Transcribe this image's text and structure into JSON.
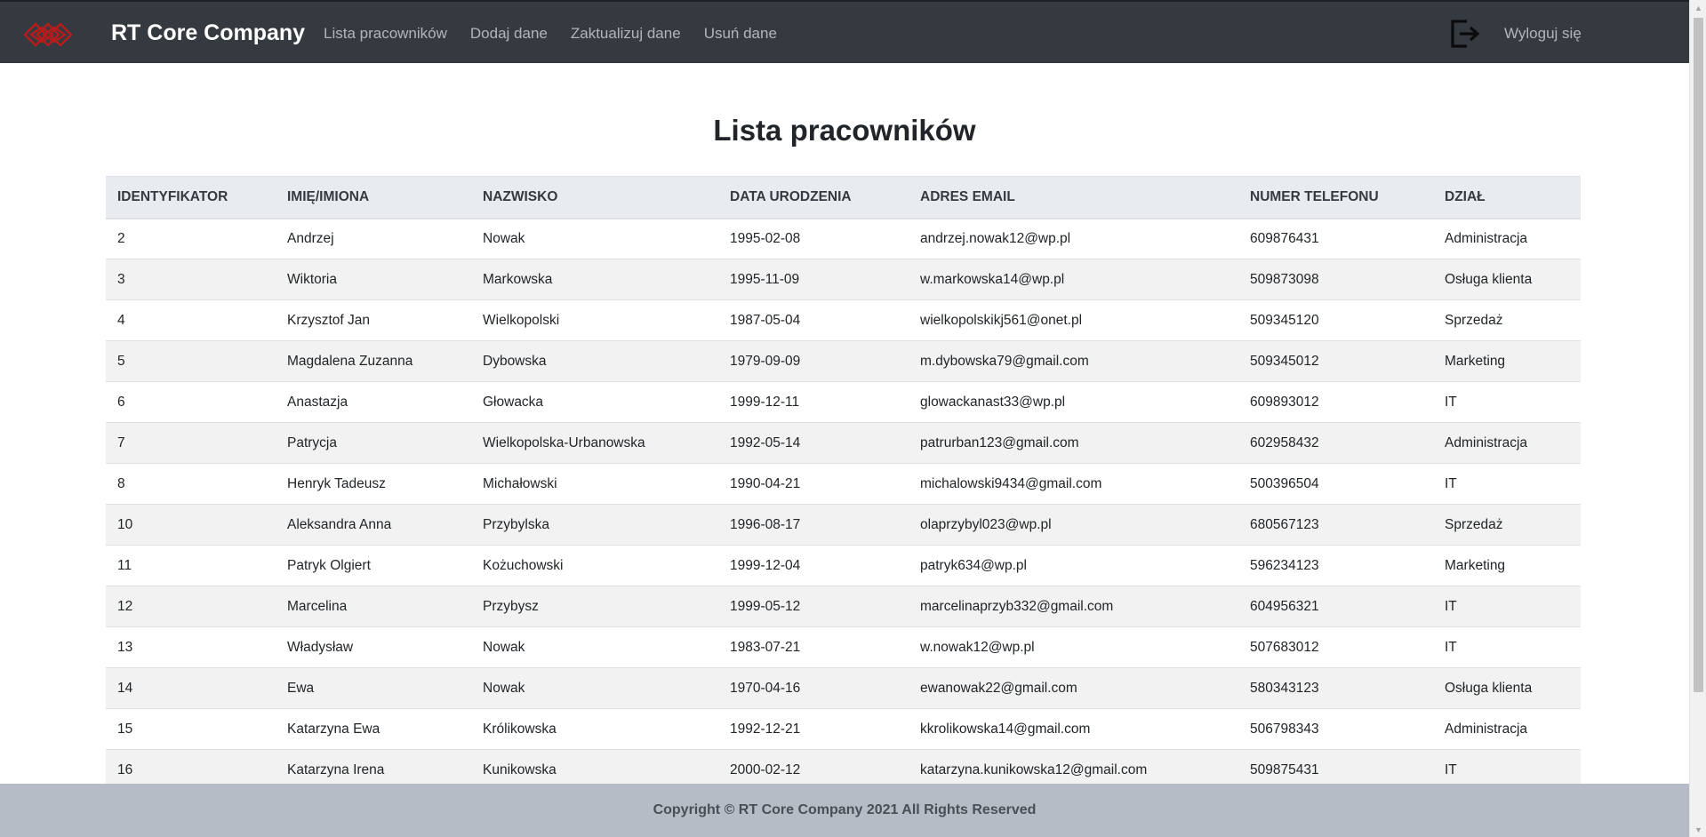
{
  "navbar": {
    "brand": "RT Core Company",
    "links": [
      "Lista pracowników",
      "Dodaj dane",
      "Zaktualizuj dane",
      "Usuń dane"
    ],
    "logout_label": "Wyloguj się",
    "logo_icon": "diamond-lattice-logo",
    "logout_icon": "logout-icon",
    "logo_color": "#b71c1c"
  },
  "main": {
    "title": "Lista pracowników"
  },
  "table": {
    "headers": [
      "IDENTYFIKATOR",
      "IMIĘ/IMIONA",
      "NAZWISKO",
      "DATA URODZENIA",
      "ADRES EMAIL",
      "NUMER TELEFONU",
      "DZIAŁ"
    ],
    "rows": [
      [
        "2",
        "Andrzej",
        "Nowak",
        "1995-02-08",
        "andrzej.nowak12@wp.pl",
        "609876431",
        "Administracja"
      ],
      [
        "3",
        "Wiktoria",
        "Markowska",
        "1995-11-09",
        "w.markowska14@wp.pl",
        "509873098",
        "Osługa klienta"
      ],
      [
        "4",
        "Krzysztof Jan",
        "Wielkopolski",
        "1987-05-04",
        "wielkopolskikj561@onet.pl",
        "509345120",
        "Sprzedaż"
      ],
      [
        "5",
        "Magdalena Zuzanna",
        "Dybowska",
        "1979-09-09",
        "m.dybowska79@gmail.com",
        "509345012",
        "Marketing"
      ],
      [
        "6",
        "Anastazja",
        "Głowacka",
        "1999-12-11",
        "glowackanast33@wp.pl",
        "609893012",
        "IT"
      ],
      [
        "7",
        "Patrycja",
        "Wielkopolska-Urbanowska",
        "1992-05-14",
        "patrurban123@gmail.com",
        "602958432",
        "Administracja"
      ],
      [
        "8",
        "Henryk Tadeusz",
        "Michałowski",
        "1990-04-21",
        "michalowski9434@gmail.com",
        "500396504",
        "IT"
      ],
      [
        "10",
        "Aleksandra Anna",
        "Przybylska",
        "1996-08-17",
        "olaprzybyl023@wp.pl",
        "680567123",
        "Sprzedaż"
      ],
      [
        "11",
        "Patryk Olgiert",
        "Kożuchowski",
        "1999-12-04",
        "patryk634@wp.pl",
        "596234123",
        "Marketing"
      ],
      [
        "12",
        "Marcelina",
        "Przybysz",
        "1999-05-12",
        "marcelinaprzyb332@gmail.com",
        "604956321",
        "IT"
      ],
      [
        "13",
        "Władysław",
        "Nowak",
        "1983-07-21",
        "w.nowak12@wp.pl",
        "507683012",
        "IT"
      ],
      [
        "14",
        "Ewa",
        "Nowak",
        "1970-04-16",
        "ewanowak22@gmail.com",
        "580343123",
        "Osługa klienta"
      ],
      [
        "15",
        "Katarzyna Ewa",
        "Królikowska",
        "1992-12-21",
        "kkrolikowska14@gmail.com",
        "506798343",
        "Administracja"
      ],
      [
        "16",
        "Katarzyna Irena",
        "Kunikowska",
        "2000-02-12",
        "katarzyna.kunikowska12@gmail.com",
        "509875431",
        "IT"
      ]
    ]
  },
  "footer": {
    "text": "Copyright © RT Core Company 2021 All Rights Reserved"
  }
}
